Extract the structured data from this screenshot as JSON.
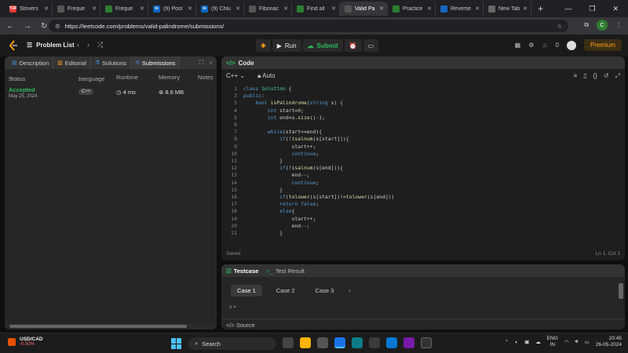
{
  "browser": {
    "tabs": [
      {
        "label": "Strivers",
        "favicon_color": "#e53935",
        "favicon_text": "TUF",
        "active": false
      },
      {
        "label": "Freque",
        "favicon_color": "#555",
        "favicon_text": "",
        "active": false
      },
      {
        "label": "Freque",
        "favicon_color": "#2e7d32",
        "favicon_text": "",
        "active": false
      },
      {
        "label": "(9) Post",
        "favicon_color": "#0a66c2",
        "favicon_text": "in",
        "active": false
      },
      {
        "label": "(9) Chlu",
        "favicon_color": "#0a66c2",
        "favicon_text": "in",
        "active": false
      },
      {
        "label": "Fibonac",
        "favicon_color": "#555",
        "favicon_text": "",
        "active": false
      },
      {
        "label": "Find all",
        "favicon_color": "#2e7d32",
        "favicon_text": "",
        "active": false
      },
      {
        "label": "Valid Pa",
        "favicon_color": "#555",
        "favicon_text": "",
        "active": true
      },
      {
        "label": "Practice",
        "favicon_color": "#2e7d32",
        "favicon_text": "",
        "active": false
      },
      {
        "label": "Reverse",
        "favicon_color": "#1565c0",
        "favicon_text": "",
        "active": false
      },
      {
        "label": "New Tab",
        "favicon_color": "#666",
        "favicon_text": "",
        "active": false
      }
    ],
    "url": "https://leetcode.com/problems/valid-palindrome/submissions/",
    "profile_initial": "C"
  },
  "lc_nav": {
    "problem_list": "Problem List",
    "run": "Run",
    "submit": "Submit",
    "streak_count": "0",
    "premium": "Premium"
  },
  "left_panel": {
    "tabs": [
      {
        "label": "Description",
        "icon": "description-icon"
      },
      {
        "label": "Editorial",
        "icon": "editorial-icon"
      },
      {
        "label": "Solutions",
        "icon": "solutions-icon"
      },
      {
        "label": "Submissions",
        "icon": "submissions-icon"
      }
    ],
    "columns": {
      "status": "Status",
      "language": "Language",
      "runtime": "Runtime",
      "memory": "Memory",
      "notes": "Notes"
    },
    "submission": {
      "status": "Accepted",
      "date": "May 25, 2024",
      "language": "C++",
      "runtime": "4 ms",
      "memory": "8.6 MB"
    }
  },
  "code_panel": {
    "title": "Code",
    "language": "C++",
    "mode": "Auto",
    "lines": [
      "class Solution {",
      "public:",
      "    bool isPalindrome(string s) {",
      "        int start=0;",
      "        int end=s.size()-1;",
      "",
      "        while(start<=end){",
      "            if(!isalnum(s[start])){",
      "                start++;",
      "                continue;",
      "            }",
      "            if(!isalnum(s[end])){",
      "                end--;",
      "                continue;",
      "            }",
      "            if(tolower(s[start])!=tolower(s[end]))",
      "            return false;",
      "            else{",
      "                start++;",
      "                end--;",
      "            }"
    ],
    "saved": "Saved",
    "cursor": "Ln 1, Col 1"
  },
  "test_panel": {
    "testcase_tab": "Testcase",
    "testresult_tab": "Test Result",
    "cases": [
      "Case 1",
      "Case 2",
      "Case 3"
    ],
    "input_label": "s =",
    "source": "Source"
  },
  "taskbar": {
    "stock_name": "USD/CAD",
    "stock_change": "-0.50%",
    "search": "Search",
    "lang_line1": "ENG",
    "lang_line2": "IN",
    "time": "20:45",
    "date": "26-05-2024"
  }
}
